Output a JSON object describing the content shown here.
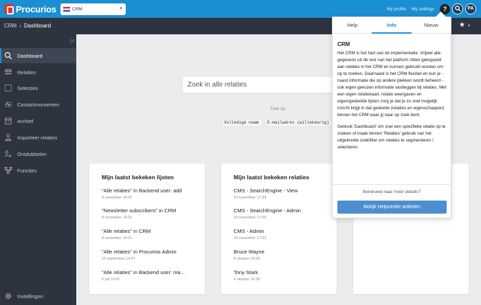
{
  "topbar": {
    "logo_text": "Procurios",
    "app_select_value": "CRM",
    "my_profile": "My profile",
    "my_settings": "My settings",
    "help_label": "?",
    "search_label": "Q",
    "avatar_initials": "PA"
  },
  "breadcrumb": {
    "root": "CRM",
    "separator": "›",
    "current": "Dashboard"
  },
  "sidebar": {
    "collapse_label": "|<",
    "items": [
      {
        "label": "Dashboard",
        "icon": "search-icon",
        "active": true
      },
      {
        "label": "Relaties",
        "icon": "people-icon"
      },
      {
        "label": "Selecties",
        "icon": "selection-icon"
      },
      {
        "label": "Contactmomenten",
        "icon": "contact-icon"
      },
      {
        "label": "Archief",
        "icon": "archive-icon"
      },
      {
        "label": "Importeer relaties",
        "icon": "import-icon"
      },
      {
        "label": "Ontdubbelen",
        "icon": "merge-icon"
      },
      {
        "label": "Functies",
        "icon": "functions-icon"
      }
    ],
    "settings_label": "Instellingen"
  },
  "search": {
    "placeholder": "Zoek in alle relaties",
    "zoek_op": "Zoek op:",
    "tags": [
      "Volledige naam",
      "E-mailadres (willekeurig)"
    ]
  },
  "cards": {
    "lists": {
      "title": "Mijn laatst bekeken lijsten",
      "items": [
        {
          "title": "\"Alle relaties\" in Backend user: add",
          "date": "8 november 14:01"
        },
        {
          "title": "\"Newsletter subscribers\" in CRM",
          "date": "8 november 14:01"
        },
        {
          "title": "\"Alle relaties\" in CRM",
          "date": "8 november 14:01"
        },
        {
          "title": "\"Alle relaties\" in Procurios Admin",
          "date": "29 september 14:47"
        },
        {
          "title": "\"Alle relaties\" in Backend user: ma...",
          "date": "5 juli 10:47"
        }
      ]
    },
    "relations": {
      "title": "Mijn laatst bekeken relaties",
      "items": [
        {
          "title": "CMS - SearchEngine - View",
          "date": "10 november 17:34"
        },
        {
          "title": "CMS - SearchEngine - Admin",
          "date": "10 november 17:34"
        },
        {
          "title": "CMS - Admin",
          "date": "10 november 17:33"
        },
        {
          "title": "Bruce Wayne",
          "date": "8 oktober 14:58"
        },
        {
          "title": "Tony Stark",
          "date": "4 oktober 16:28"
        }
      ]
    }
  },
  "popover": {
    "tabs": [
      "Help",
      "Info",
      "Nieuw"
    ],
    "active_tab": "Info",
    "title": "CRM",
    "paragraph1": "Het CRM is het hart van de implementatie. Vrijwel alle gegevens uit de rest van het platform zitten gekoppeld aan relaties in het CRM en kunnen gebruikt worden om op te zoeken. Daarnaast is het CRM flexibel en kun je - naast informatie die op andere plekken wordt beheerd - ook eigen gekozen informatie vastleggen bij relaties. Met een eigen relatiekaart, relatie weergaven en eigen/gedeelde lijsten zorg je dat je zo snel mogelijk inzicht krijgt in dat gedeelte (relaties en eigenschappen) binnen het CRM waar jij naar op zoek bent.",
    "paragraph2": "Gebruik 'Dashboard' om snel een specifieke relatie op te zoeken of maak binnen 'Relaties' gebruik van het uitgebreide zoekfilter om relaties te segmenteren / selecteren.",
    "more_prompt": "Benieuwd naar meer details?",
    "button_label": "Bekijk Helpcenter artikelen"
  },
  "colors": {
    "topbar": "#1a8fd1",
    "sidebar": "#2d3440",
    "accent": "#1a8fd1",
    "button": "#4d8ed1"
  }
}
